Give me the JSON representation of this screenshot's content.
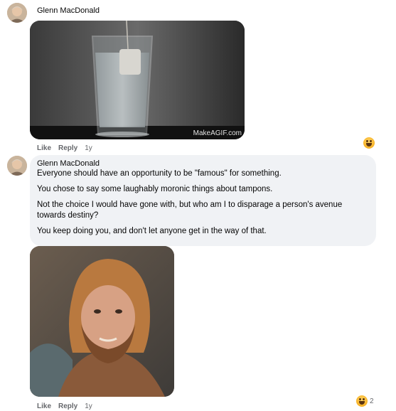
{
  "comment1": {
    "author": "Glenn MacDonald",
    "gif_watermark": "MakeAGIF.com",
    "actions": {
      "like": "Like",
      "reply": "Reply",
      "time": "1y"
    },
    "reaction_icon": "haha-emoji-icon"
  },
  "comment2": {
    "author": "Glenn MacDonald",
    "paragraphs": [
      "Everyone should have an opportunity to be \"famous\" for something.",
      "You chose to say some laughably moronic things about tampons.",
      "Not the choice I would have gone with, but who am I to disparage a person's avenue towards destiny?",
      "You keep doing you, and don't let anyone get in the way of that."
    ],
    "actions": {
      "like": "Like",
      "reply": "Reply",
      "time": "1y"
    },
    "reaction_icon": "haha-emoji-icon",
    "reaction_count": "2"
  }
}
